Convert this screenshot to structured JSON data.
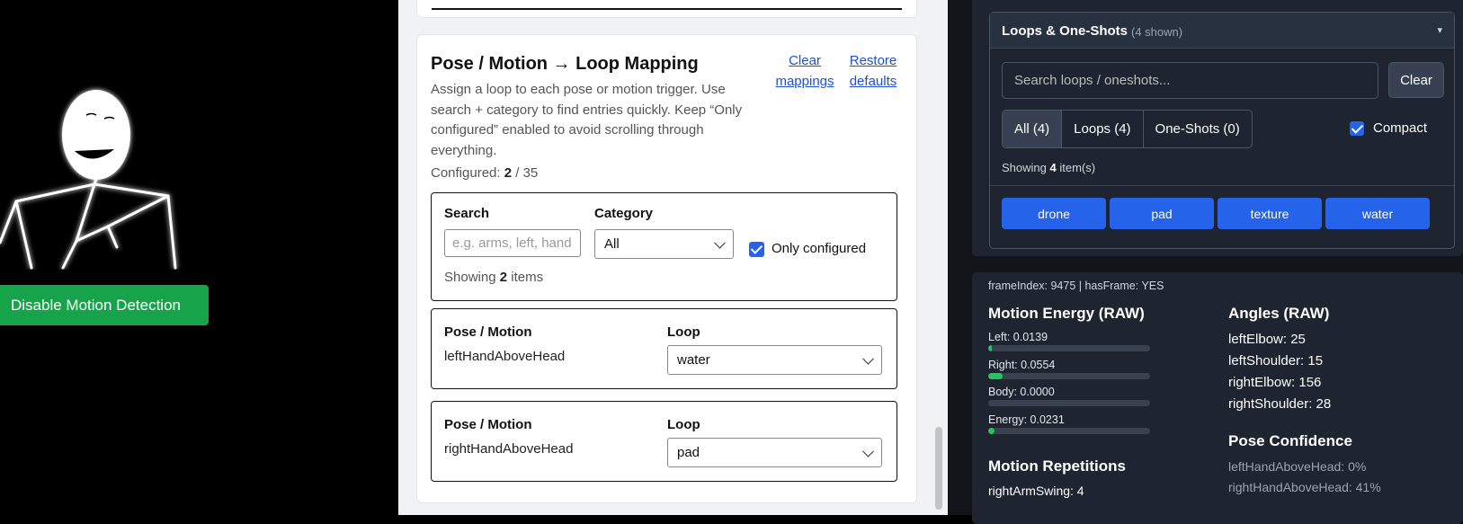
{
  "left": {
    "motion_button": "Disable Motion Detection"
  },
  "mapping": {
    "title": "Pose / Motion → Loop Mapping",
    "clear_link": "Clear mappings",
    "restore_link": "Restore defaults",
    "description": "Assign a loop to each pose or motion trigger. Use search + category to find entries quickly. Keep “Only configured” enabled to avoid scrolling through everything.",
    "configured_label": "Configured:",
    "configured_count": "2",
    "configured_total": "/ 35",
    "filter": {
      "search_label": "Search",
      "search_placeholder": "e.g. arms, left, hand",
      "category_label": "Category",
      "category_value": "All",
      "only_configured_label": "Only configured",
      "only_configured_checked": true,
      "showing_prefix": "Showing",
      "showing_count": "2",
      "showing_suffix": "items"
    },
    "rows": [
      {
        "pose_label": "Pose / Motion",
        "pose_value": "leftHandAboveHead",
        "loop_label": "Loop",
        "loop_value": "water"
      },
      {
        "pose_label": "Pose / Motion",
        "pose_value": "rightHandAboveHead",
        "loop_label": "Loop",
        "loop_value": "pad"
      }
    ]
  },
  "loops": {
    "title": "Loops & One-Shots",
    "count_label": "(4 shown)",
    "caret": "▾",
    "search_placeholder": "Search loops / oneshots...",
    "clear_label": "Clear",
    "segments": [
      {
        "label": "All (4)",
        "active": true
      },
      {
        "label": "Loops (4)",
        "active": false
      },
      {
        "label": "One-Shots (0)",
        "active": false
      }
    ],
    "compact_label": "Compact",
    "compact_checked": true,
    "showing_prefix": "Showing",
    "showing_count": "4",
    "showing_suffix": "item(s)",
    "tiles": [
      "drone",
      "pad",
      "texture",
      "water"
    ]
  },
  "debug": {
    "frame_info": "frameIndex: 9475 | hasFrame: YES",
    "energy_title": "Motion Energy (RAW)",
    "energy": [
      {
        "label": "Left: 0.0139",
        "fraction": 0.0139
      },
      {
        "label": "Right: 0.0554",
        "fraction": 0.0554
      },
      {
        "label": "Body: 0.0000",
        "fraction": 0.0
      },
      {
        "label": "Energy: 0.0231",
        "fraction": 0.0231
      }
    ],
    "repetitions_title": "Motion Repetitions",
    "repetitions": [
      "rightArmSwing: 4"
    ],
    "angles_title": "Angles (RAW)",
    "angles": [
      "leftElbow: 25",
      "leftShoulder: 15",
      "rightElbow: 156",
      "rightShoulder: 28"
    ],
    "confidence_title": "Pose Confidence",
    "confidence": [
      "leftHandAboveHead: 0%",
      "rightHandAboveHead: 41%"
    ]
  },
  "colors": {
    "motion_button": "#16a34a",
    "accent": "#2563eb",
    "link": "#1d4ed8",
    "energy_bar": "#22c55e"
  }
}
